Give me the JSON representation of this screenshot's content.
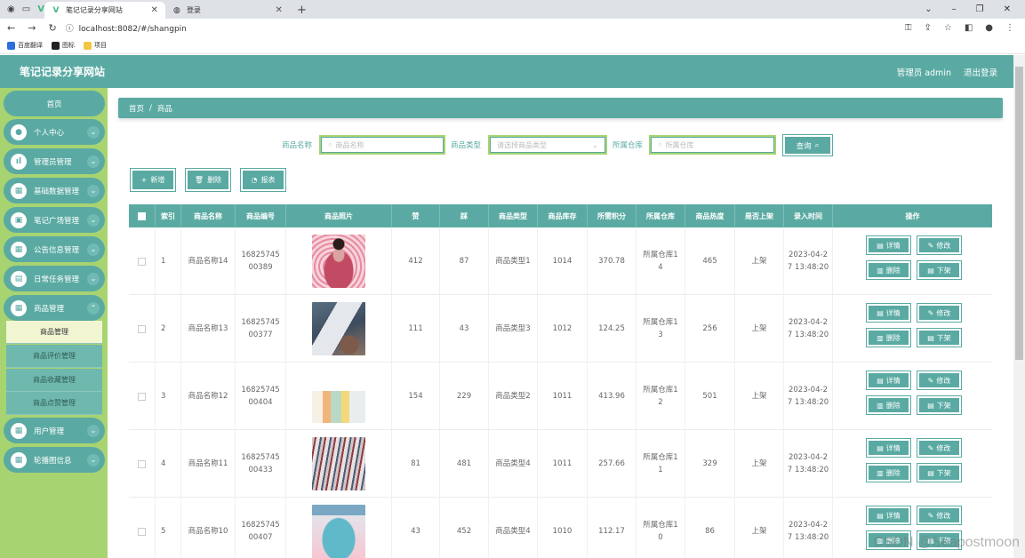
{
  "browser": {
    "tabs": [
      {
        "title": "笔记记录分享网站",
        "active": true
      },
      {
        "title": "登录",
        "active": false
      }
    ],
    "url": "localhost:8082/#/shangpin",
    "bookmarks": [
      "百度翻译",
      "图标",
      "项目"
    ]
  },
  "app": {
    "title": "笔记记录分享网站",
    "user_label": "管理员 admin",
    "logout": "退出登录"
  },
  "sidebar": {
    "home": "首页",
    "items": [
      {
        "label": "个人中心",
        "icon": "person-icon"
      },
      {
        "label": "管理员管理",
        "icon": "bar-chart-icon"
      },
      {
        "label": "基础数据管理",
        "icon": "grid-icon"
      },
      {
        "label": "笔记广场管理",
        "icon": "briefcase-icon"
      },
      {
        "label": "公告信息管理",
        "icon": "grid-icon"
      },
      {
        "label": "日常任务管理",
        "icon": "clipboard-icon"
      },
      {
        "label": "商品管理",
        "icon": "grid-icon"
      },
      {
        "label": "用户管理",
        "icon": "grid-icon"
      },
      {
        "label": "轮播图信息",
        "icon": "grid-icon"
      }
    ],
    "submenu": [
      "商品管理",
      "商品评价管理",
      "商品收藏管理",
      "商品点赞管理"
    ]
  },
  "breadcrumb": {
    "home": "首页",
    "sep": "/",
    "current": "商品"
  },
  "search": {
    "name_label": "商品名称",
    "name_placeholder": "商品名称",
    "type_label": "商品类型",
    "type_placeholder": "请选择商品类型",
    "warehouse_label": "所属仓库",
    "warehouse_placeholder": "所属仓库",
    "query_btn": "查询"
  },
  "actions": {
    "add": "新增",
    "delete": "删除",
    "report": "报表"
  },
  "table": {
    "headers": [
      "索引",
      "商品名称",
      "商品编号",
      "商品照片",
      "赞",
      "踩",
      "商品类型",
      "商品库存",
      "所需积分",
      "所属仓库",
      "商品热度",
      "是否上架",
      "录入时间",
      "操作"
    ],
    "ops": {
      "detail": "详情",
      "edit": "修改",
      "delete": "删除",
      "offshelf": "下架"
    },
    "rows": [
      {
        "idx": "1",
        "name": "商品名称14",
        "code1": "16825745",
        "code2": "00389",
        "likes": "412",
        "dislikes": "87",
        "type": "商品类型1",
        "stock": "1014",
        "points": "370.78",
        "wh1": "所属仓库1",
        "wh2": "4",
        "heat": "465",
        "onshelf": "上架",
        "t1": "2023-04-2",
        "t2": "7 13:48:20",
        "img": "dress-photo"
      },
      {
        "idx": "2",
        "name": "商品名称13",
        "code1": "16825745",
        "code2": "00377",
        "likes": "111",
        "dislikes": "43",
        "type": "商品类型3",
        "stock": "1012",
        "points": "124.25",
        "wh1": "所属仓库1",
        "wh2": "3",
        "heat": "256",
        "onshelf": "上架",
        "t1": "2023-04-2",
        "t2": "7 13:48:20",
        "img": "phone-photo"
      },
      {
        "idx": "3",
        "name": "商品名称12",
        "code1": "16825745",
        "code2": "00404",
        "likes": "154",
        "dislikes": "229",
        "type": "商品类型2",
        "stock": "1011",
        "points": "413.96",
        "wh1": "所属仓库1",
        "wh2": "2",
        "heat": "501",
        "onshelf": "上架",
        "t1": "2023-04-2",
        "t2": "7 13:48:20",
        "img": "desk-photo"
      },
      {
        "idx": "4",
        "name": "商品名称11",
        "code1": "16825745",
        "code2": "00433",
        "likes": "81",
        "dislikes": "481",
        "type": "商品类型4",
        "stock": "1011",
        "points": "257.66",
        "wh1": "所属仓库1",
        "wh2": "1",
        "heat": "329",
        "onshelf": "上架",
        "t1": "2023-04-2",
        "t2": "7 13:48:20",
        "img": "lanyard-photo"
      },
      {
        "idx": "5",
        "name": "商品名称10",
        "code1": "16825745",
        "code2": "00407",
        "likes": "43",
        "dislikes": "452",
        "type": "商品类型4",
        "stock": "1010",
        "points": "112.17",
        "wh1": "所属仓库1",
        "wh2": "0",
        "heat": "86",
        "onshelf": "上架",
        "t1": "2023-04-2",
        "t2": "7 13:48:20",
        "img": "box-photo"
      }
    ]
  },
  "watermark": "CSDN @Seapostmoon",
  "colors": {
    "primary": "#5aaaa3",
    "sidebar": "#a7d371",
    "submenu_active": "#f1f5d2"
  }
}
